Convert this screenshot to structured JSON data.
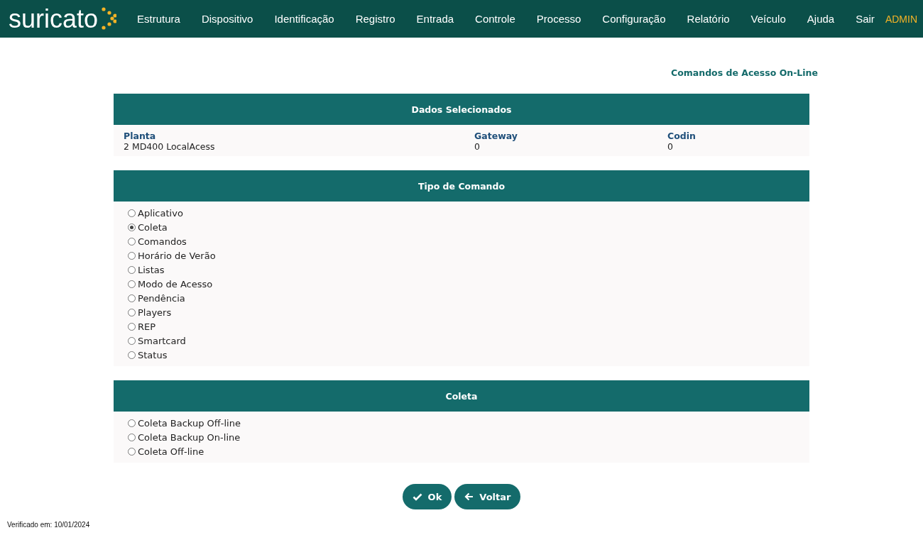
{
  "header": {
    "logo": "suricato",
    "menu": [
      {
        "label": "Estrutura"
      },
      {
        "label": "Dispositivo"
      },
      {
        "label": "Identificação"
      },
      {
        "label": "Registro"
      },
      {
        "label": "Entrada"
      },
      {
        "label": "Controle"
      },
      {
        "label": "Processo"
      },
      {
        "label": "Configuração"
      },
      {
        "label": "Relatório"
      },
      {
        "label": "Veículo"
      },
      {
        "label": "Ajuda"
      },
      {
        "label": "Sair"
      }
    ],
    "user": "ADMIN"
  },
  "page_title": "Comandos de Acesso On-Line",
  "selected_data": {
    "title": "Dados Selecionados",
    "fields": [
      {
        "label": "Planta",
        "value": "2 MD400 LocalAcess"
      },
      {
        "label": "Gateway",
        "value": "0"
      },
      {
        "label": "Codin",
        "value": "0"
      }
    ]
  },
  "command_type": {
    "title": "Tipo de Comando",
    "options": [
      {
        "label": "Aplicativo",
        "selected": false
      },
      {
        "label": "Coleta",
        "selected": true
      },
      {
        "label": "Comandos",
        "selected": false
      },
      {
        "label": "Horário de Verão",
        "selected": false
      },
      {
        "label": "Listas",
        "selected": false
      },
      {
        "label": "Modo de Acesso",
        "selected": false
      },
      {
        "label": "Pendência",
        "selected": false
      },
      {
        "label": "Players",
        "selected": false
      },
      {
        "label": "REP",
        "selected": false
      },
      {
        "label": "Smartcard",
        "selected": false
      },
      {
        "label": "Status",
        "selected": false
      }
    ]
  },
  "collect": {
    "title": "Coleta",
    "options": [
      {
        "label": "Coleta Backup Off-line",
        "selected": false
      },
      {
        "label": "Coleta Backup On-line",
        "selected": false
      },
      {
        "label": "Coleta Off-line",
        "selected": false
      }
    ]
  },
  "buttons": [
    {
      "kind": "ok",
      "label": "Ok"
    },
    {
      "kind": "back",
      "label": "Voltar"
    }
  ],
  "footer": "Verificado em: 10/01/2024"
}
